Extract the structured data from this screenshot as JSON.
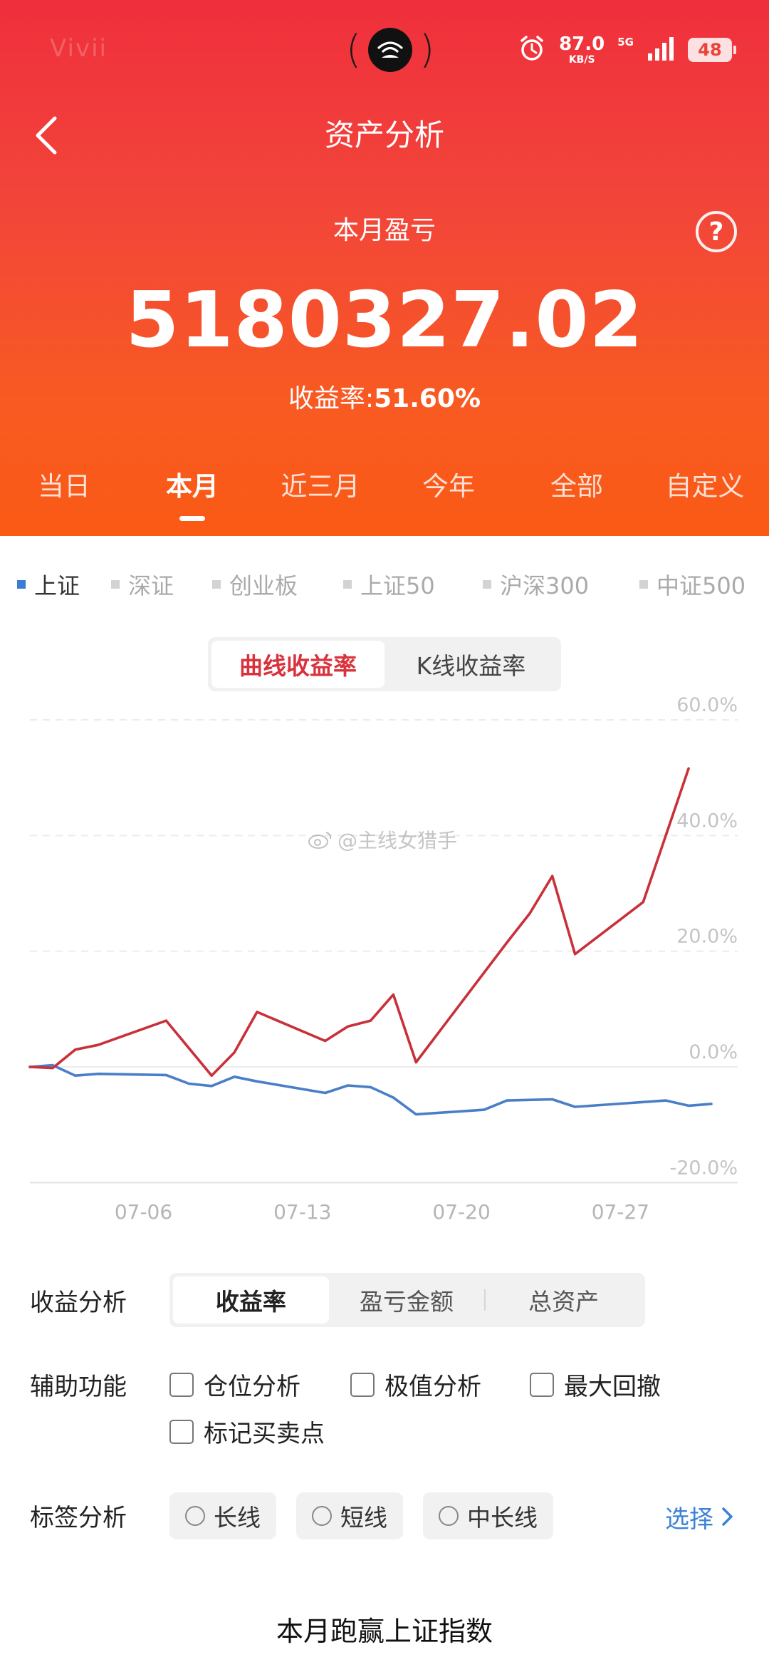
{
  "status_bar": {
    "carrier": "Vivii",
    "speed_value": "87.0",
    "speed_unit": "KB/S",
    "network": "5G",
    "battery": "48"
  },
  "header": {
    "title": "资产分析",
    "subtitle": "本月盈亏",
    "amount": "5180327.02",
    "yield_label": "收益率:",
    "yield_value": "51.60%",
    "help_glyph": "?"
  },
  "period_tabs": [
    "当日",
    "本月",
    "近三月",
    "今年",
    "全部",
    "自定义"
  ],
  "active_period": "本月",
  "index_legend": [
    "上证",
    "深证",
    "创业板",
    "上证50",
    "沪深300",
    "中证500"
  ],
  "active_index": "上证",
  "chart_toggle": {
    "options": [
      "曲线收益率",
      "K线收益率"
    ],
    "active": "曲线收益率"
  },
  "watermark": "@主线女猎手",
  "chart_data": {
    "type": "line",
    "x_tick_labels": [
      "07-06",
      "07-13",
      "07-20",
      "07-27"
    ],
    "y_tick_labels": [
      "60.0%",
      "40.0%",
      "20.0%",
      "0.0%",
      "-20.0%"
    ],
    "ylim": [
      -20,
      60
    ],
    "grid": true,
    "series": [
      {
        "color": "#c8313a",
        "points": [
          [
            0,
            0.0
          ],
          [
            1,
            -0.2
          ],
          [
            2,
            3.0
          ],
          [
            3,
            3.8
          ],
          [
            6,
            8.0
          ],
          [
            8,
            -1.5
          ],
          [
            9,
            2.5
          ],
          [
            10,
            9.5
          ],
          [
            13,
            4.5
          ],
          [
            14,
            7.0
          ],
          [
            15,
            8.0
          ],
          [
            16,
            12.5
          ],
          [
            17,
            0.8
          ],
          [
            21,
            21.5
          ],
          [
            22,
            26.5
          ],
          [
            23,
            33.0
          ],
          [
            24,
            19.5
          ],
          [
            27,
            28.5
          ],
          [
            29,
            51.6
          ]
        ]
      },
      {
        "color": "#4a7fc7",
        "points": [
          [
            0,
            0.0
          ],
          [
            1,
            0.3
          ],
          [
            2,
            -1.5
          ],
          [
            3,
            -1.2
          ],
          [
            6,
            -1.4
          ],
          [
            7,
            -2.9
          ],
          [
            8,
            -3.3
          ],
          [
            9,
            -1.7
          ],
          [
            10,
            -2.5
          ],
          [
            13,
            -4.5
          ],
          [
            14,
            -3.2
          ],
          [
            15,
            -3.5
          ],
          [
            16,
            -5.3
          ],
          [
            17,
            -8.2
          ],
          [
            20,
            -7.4
          ],
          [
            21,
            -5.8
          ],
          [
            23,
            -5.6
          ],
          [
            24,
            -6.9
          ],
          [
            28,
            -5.8
          ],
          [
            29,
            -6.7
          ],
          [
            30,
            -6.4
          ]
        ]
      }
    ]
  },
  "analysis": {
    "label": "收益分析",
    "options": [
      "收益率",
      "盈亏金额",
      "总资产"
    ],
    "active": "收益率"
  },
  "aux": {
    "label": "辅助功能",
    "options": [
      "仓位分析",
      "极值分析",
      "最大回撤",
      "标记买卖点"
    ]
  },
  "tags": {
    "label": "标签分析",
    "options": [
      "长线",
      "短线",
      "中长线"
    ],
    "select_label": "选择"
  },
  "bottom_summary": "本月跑赢上证指数"
}
